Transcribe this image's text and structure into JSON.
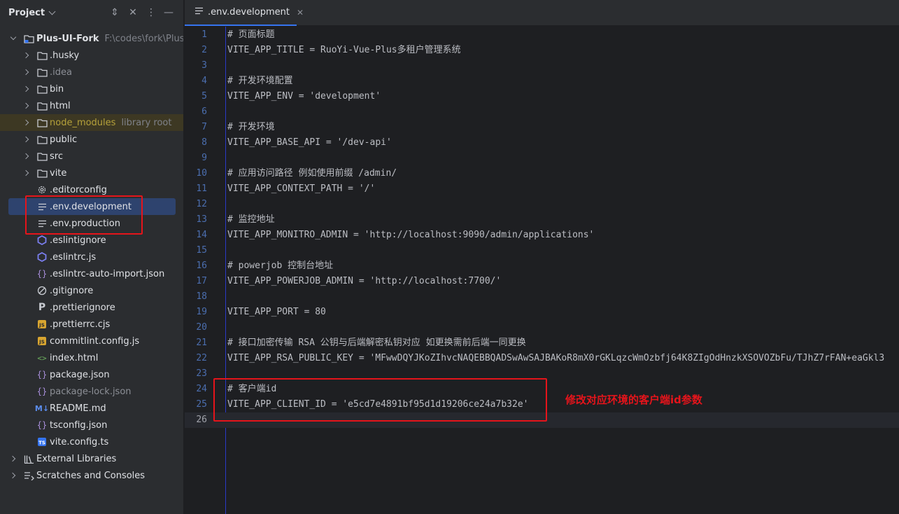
{
  "sidebar": {
    "title": "Project",
    "items": [
      {
        "label": "Plus-UI-Fork",
        "hint": "F:\\codes\\fork\\Plus-UI",
        "icon": "project-folder-icon",
        "type": "root"
      },
      {
        "label": ".husky",
        "icon": "folder-icon"
      },
      {
        "label": ".idea",
        "icon": "folder-icon"
      },
      {
        "label": "bin",
        "icon": "folder-icon"
      },
      {
        "label": "html",
        "icon": "folder-icon"
      },
      {
        "label": "node_modules",
        "hint": "library root",
        "icon": "folder-icon"
      },
      {
        "label": "public",
        "icon": "folder-icon"
      },
      {
        "label": "src",
        "icon": "folder-icon"
      },
      {
        "label": "vite",
        "icon": "folder-icon"
      },
      {
        "label": ".editorconfig",
        "icon": "gear-icon"
      },
      {
        "label": ".env.development",
        "icon": "text-file-icon"
      },
      {
        "label": ".env.production",
        "icon": "text-file-icon"
      },
      {
        "label": ".eslintignore",
        "icon": "eslint-icon"
      },
      {
        "label": ".eslintrc.js",
        "icon": "eslint-icon"
      },
      {
        "label": ".eslintrc-auto-import.json",
        "icon": "json-icon"
      },
      {
        "label": ".gitignore",
        "icon": "ignore-icon"
      },
      {
        "label": ".prettierignore",
        "icon": "prettier-icon"
      },
      {
        "label": ".prettierrc.cjs",
        "icon": "js-icon"
      },
      {
        "label": "commitlint.config.js",
        "icon": "js-icon"
      },
      {
        "label": "index.html",
        "icon": "html-icon"
      },
      {
        "label": "package.json",
        "icon": "json-icon"
      },
      {
        "label": "package-lock.json",
        "icon": "json-icon"
      },
      {
        "label": "README.md",
        "icon": "markdown-icon"
      },
      {
        "label": "tsconfig.json",
        "icon": "json-icon"
      },
      {
        "label": "vite.config.ts",
        "icon": "ts-icon"
      },
      {
        "label": "External Libraries",
        "icon": "library-icon"
      },
      {
        "label": "Scratches and Consoles",
        "icon": "scratches-icon"
      }
    ]
  },
  "editor": {
    "tab_label": ".env.development",
    "annotation": "修改对应环境的客户端id参数",
    "lines": [
      {
        "n": "1",
        "text": "# 页面标题"
      },
      {
        "n": "2",
        "text": "VITE_APP_TITLE = RuoYi-Vue-Plus多租户管理系统"
      },
      {
        "n": "3",
        "text": ""
      },
      {
        "n": "4",
        "text": "# 开发环境配置"
      },
      {
        "n": "5",
        "text": "VITE_APP_ENV = 'development'"
      },
      {
        "n": "6",
        "text": ""
      },
      {
        "n": "7",
        "text": "# 开发环境"
      },
      {
        "n": "8",
        "text": "VITE_APP_BASE_API = '/dev-api'"
      },
      {
        "n": "9",
        "text": ""
      },
      {
        "n": "10",
        "text": "# 应用访问路径 例如使用前缀 /admin/"
      },
      {
        "n": "11",
        "text": "VITE_APP_CONTEXT_PATH = '/'"
      },
      {
        "n": "12",
        "text": ""
      },
      {
        "n": "13",
        "text": "# 监控地址"
      },
      {
        "n": "14",
        "text": "VITE_APP_MONITRO_ADMIN = 'http://localhost:9090/admin/applications'"
      },
      {
        "n": "15",
        "text": ""
      },
      {
        "n": "16",
        "text": "# powerjob 控制台地址"
      },
      {
        "n": "17",
        "text": "VITE_APP_POWERJOB_ADMIN = 'http://localhost:7700/'"
      },
      {
        "n": "18",
        "text": ""
      },
      {
        "n": "19",
        "text": "VITE_APP_PORT = 80"
      },
      {
        "n": "20",
        "text": ""
      },
      {
        "n": "21",
        "text": "# 接口加密传输 RSA 公钥与后端解密私钥对应 如更换需前后端一同更换"
      },
      {
        "n": "22",
        "text": "VITE_APP_RSA_PUBLIC_KEY = 'MFwwDQYJKoZIhvcNAQEBBQADSwAwSAJBAKoR8mX0rGKLqzcWmOzbfj64K8ZIgOdHnzkXSOVOZbFu/TJhZ7rFAN+eaGkl3"
      },
      {
        "n": "23",
        "text": ""
      },
      {
        "n": "24",
        "text": "# 客户端id"
      },
      {
        "n": "25",
        "text": "VITE_APP_CLIENT_ID = 'e5cd7e4891bf95d1d19206ce24a7b32e'"
      },
      {
        "n": "26",
        "text": ""
      }
    ]
  }
}
